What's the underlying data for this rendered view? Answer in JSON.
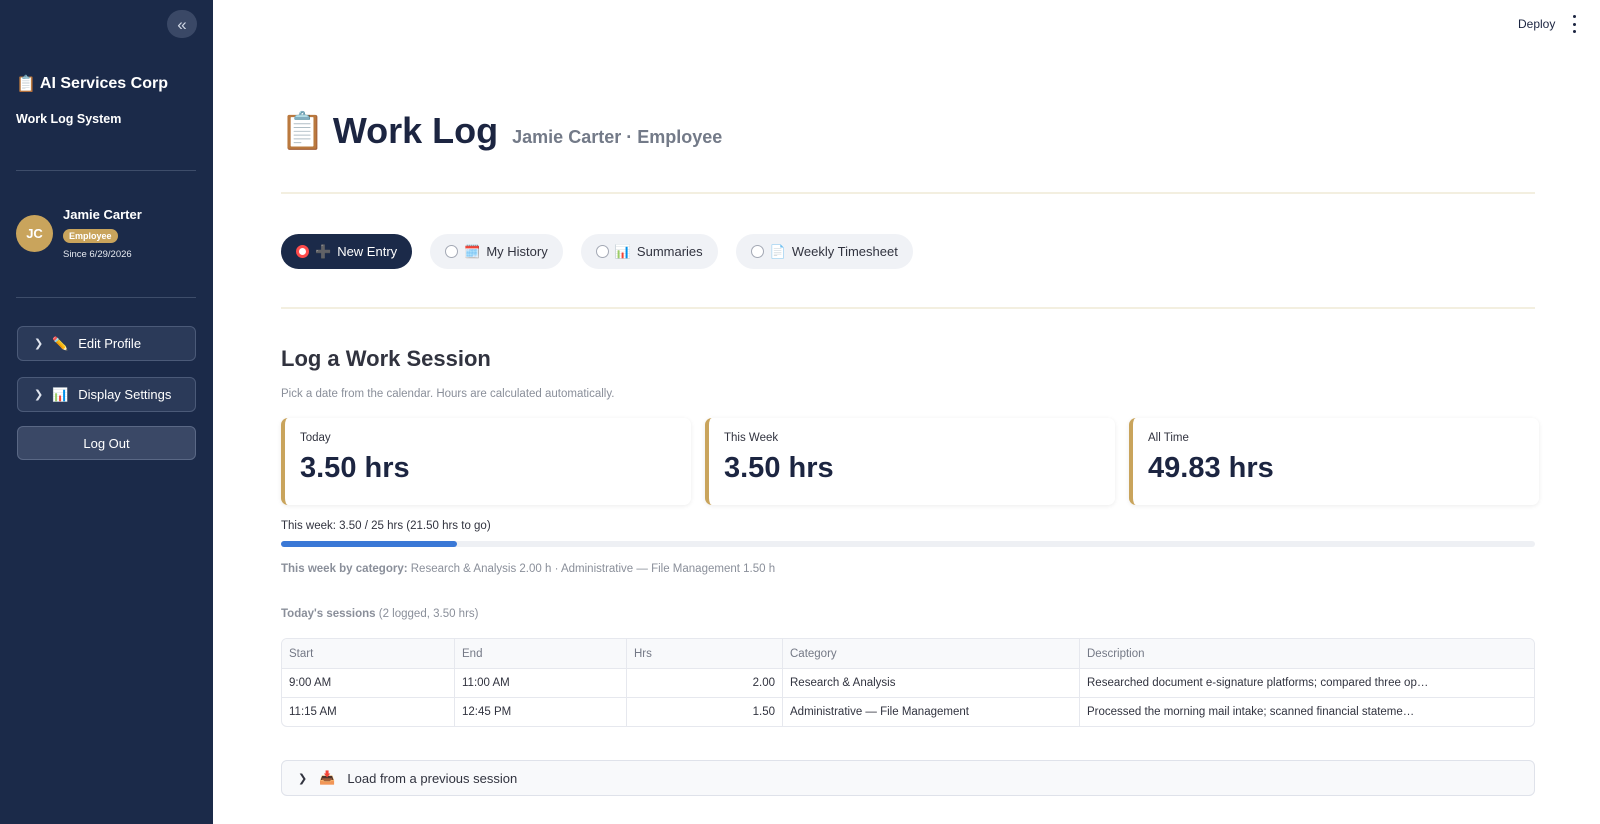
{
  "sidebar": {
    "collapse_icon": "«",
    "brand": {
      "icon": "📋",
      "name": "AI Services Corp"
    },
    "subtitle": "Work Log System",
    "user": {
      "initials": "JC",
      "name": "Jamie Carter",
      "role": "Employee",
      "since": "Since 6/29/2026"
    },
    "expanders": [
      {
        "icon": "✏️",
        "label": "Edit Profile"
      },
      {
        "icon": "📊",
        "label": "Display Settings"
      }
    ],
    "logout_label": "Log Out"
  },
  "topbar": {
    "deploy_label": "Deploy"
  },
  "header": {
    "icon": "📋",
    "title": "Work Log",
    "subtitle": "Jamie Carter · Employee"
  },
  "tabs": [
    {
      "icon": "➕",
      "label": "New Entry",
      "selected": true
    },
    {
      "icon": "🗓️",
      "label": "My History",
      "selected": false
    },
    {
      "icon": "📊",
      "label": "Summaries",
      "selected": false
    },
    {
      "icon": "📄",
      "label": "Weekly Timesheet",
      "selected": false
    }
  ],
  "section": {
    "title": "Log a Work Session",
    "hint": "Pick a date from the calendar. Hours are calculated automatically."
  },
  "metrics": [
    {
      "label": "Today",
      "value": "3.50 hrs"
    },
    {
      "label": "This Week",
      "value": "3.50 hrs"
    },
    {
      "label": "All Time",
      "value": "49.83 hrs"
    }
  ],
  "progress": {
    "label": "This week: 3.50 / 25 hrs (21.50 hrs to go)",
    "fraction": 0.14
  },
  "by_category": {
    "label": "This week by category:",
    "text": "Research & Analysis 2.00 h · Administrative — File Management 1.50 h"
  },
  "today_sessions": {
    "label": "Today's sessions",
    "detail": "(2 logged, 3.50 hrs)"
  },
  "table": {
    "columns": [
      "Start",
      "End",
      "Hrs",
      "Category",
      "Description"
    ],
    "rows": [
      [
        "9:00 AM",
        "11:00 AM",
        "2.00",
        "Research & Analysis",
        "Researched document e-signature platforms; compared three op…"
      ],
      [
        "11:15 AM",
        "12:45 PM",
        "1.50",
        "Administrative — File Management",
        "Processed the morning mail intake; scanned financial stateme…"
      ]
    ]
  },
  "load_previous": {
    "icon": "📥",
    "label": "Load from a previous session"
  },
  "colors": {
    "sidebar_bg": "#1b2a49",
    "accent_gold": "#c9a45c",
    "progress_blue": "#3a78d6",
    "active_radio": "#ff4b4b"
  }
}
